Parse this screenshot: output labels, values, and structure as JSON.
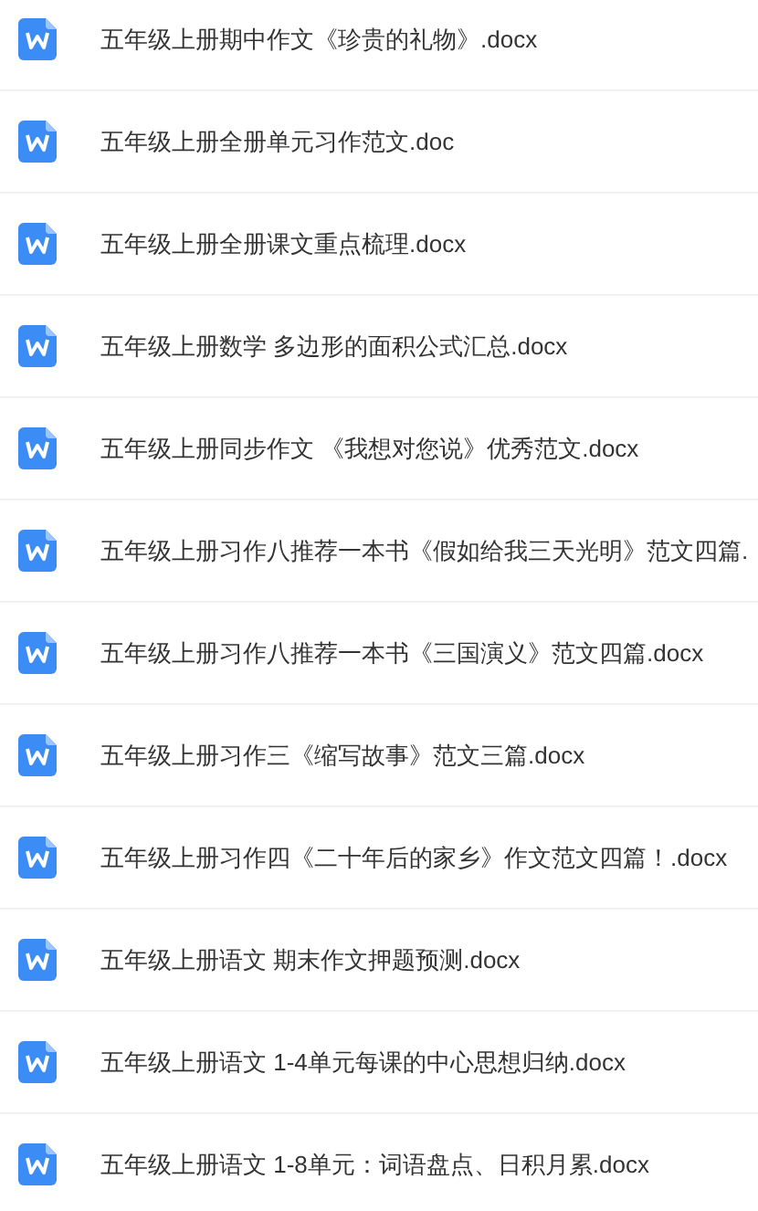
{
  "files": [
    {
      "name": "五年级上册期中作文《珍贵的礼物》.docx"
    },
    {
      "name": "五年级上册全册单元习作范文.doc"
    },
    {
      "name": "五年级上册全册课文重点梳理.docx"
    },
    {
      "name": "五年级上册数学 多边形的面积公式汇总.docx"
    },
    {
      "name": "五年级上册同步作文 《我想对您说》优秀范文.docx"
    },
    {
      "name": "五年级上册习作八推荐一本书《假如给我三天光明》范文四篇."
    },
    {
      "name": "五年级上册习作八推荐一本书《三国演义》范文四篇.docx"
    },
    {
      "name": "五年级上册习作三《缩写故事》范文三篇.docx"
    },
    {
      "name": "五年级上册习作四《二十年后的家乡》作文范文四篇！.docx"
    },
    {
      "name": "五年级上册语文 期末作文押题预测.docx"
    },
    {
      "name": "五年级上册语文 1-4单元每课的中心思想归纳.docx"
    },
    {
      "name": "五年级上册语文 1-8单元：词语盘点、日积月累.docx"
    }
  ]
}
